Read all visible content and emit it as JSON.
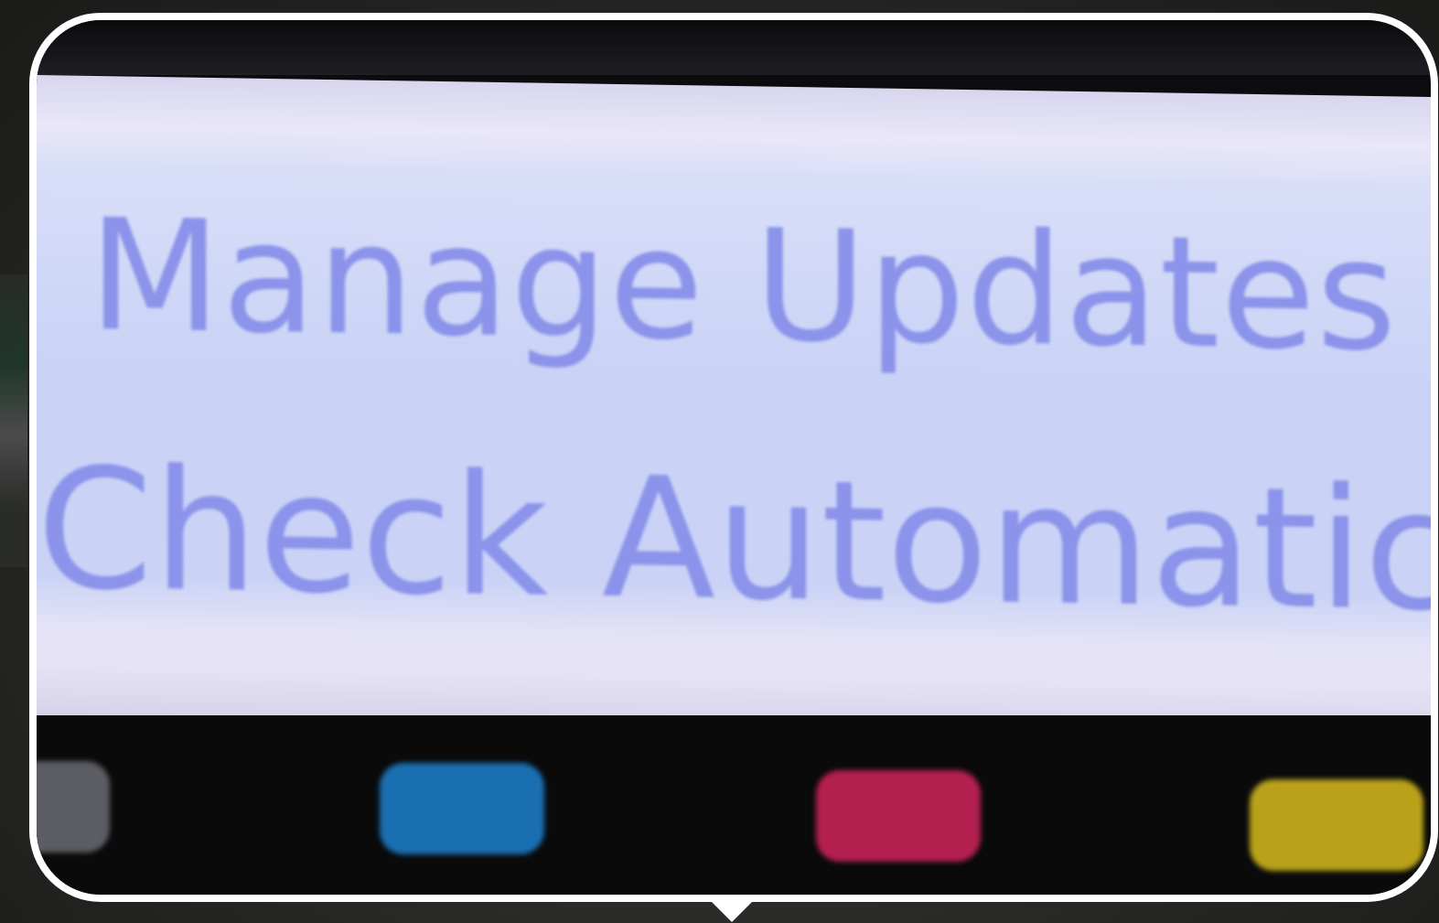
{
  "display": {
    "line1": "Manage Updates",
    "line2": "Check Automatically",
    "text_color": "#8b93ea",
    "background_color": "#cad3f6"
  },
  "buttons": [
    {
      "color_name": "gray",
      "color": "#5b5d63"
    },
    {
      "color_name": "blue",
      "color": "#1a6fb0"
    },
    {
      "color_name": "magenta",
      "color": "#b3204f"
    },
    {
      "color_name": "yellow",
      "color": "#b9a21a"
    }
  ]
}
